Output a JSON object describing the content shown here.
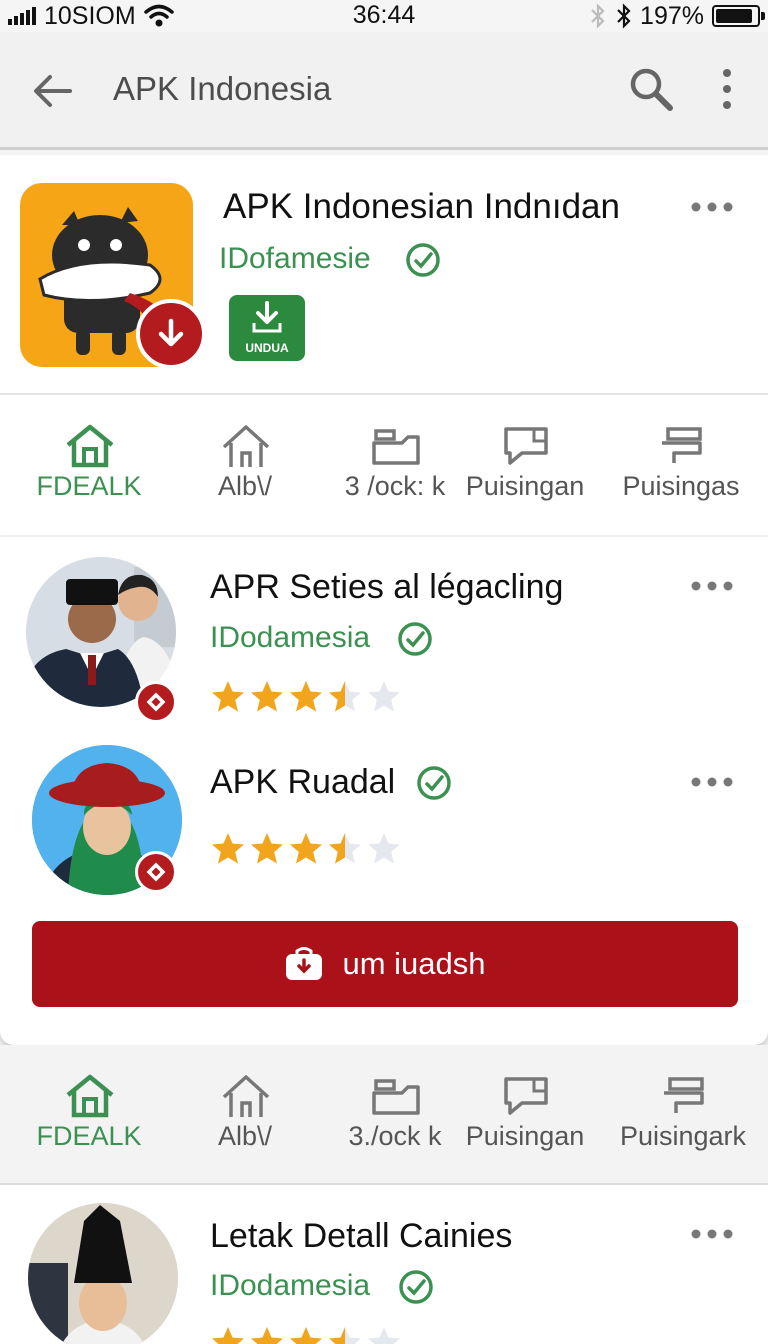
{
  "status": {
    "carrier": "10SIOM",
    "time": "36:44",
    "battery": "197%",
    "battery_level": 0.9
  },
  "app_bar": {
    "title": "APK Indonesia",
    "back_icon": "arrow-left-icon",
    "search_icon": "search-icon",
    "more_icon": "more-vertical-icon"
  },
  "featured": {
    "title": "APK Indonesian Indnıdan",
    "publisher": "IDofamesie",
    "download_label": "UNDUA"
  },
  "nav": {
    "items": [
      {
        "label": "FDEALK",
        "icon": "home-icon"
      },
      {
        "label": "Alb\\/",
        "icon": "home-outline-icon"
      },
      {
        "label": "3 /ock: k",
        "icon": "tray-icon"
      },
      {
        "label": "Puisingan",
        "icon": "chat-icon"
      },
      {
        "label": "Puisingas",
        "icon": "tag-icon"
      }
    ]
  },
  "nav2": {
    "items": [
      {
        "label": "FDEALK"
      },
      {
        "label": "Alb\\/"
      },
      {
        "label": "3./ock k"
      },
      {
        "label": "Puisingan"
      },
      {
        "label": "Puisingark"
      }
    ]
  },
  "list": {
    "items": [
      {
        "title": "APR Seties al légacling",
        "publisher": "IDodamesia",
        "rating": 3.5
      },
      {
        "title": "APK Ruadal",
        "publisher": "",
        "rating": 3.5
      }
    ],
    "button_label": "um iuadsh"
  },
  "bottom": {
    "title": "Letak Detall Cainies",
    "publisher": "IDodamesia"
  },
  "colors": {
    "green": "#3c9152",
    "red": "#ab1118",
    "orange": "#f6a516",
    "star": "#f0a51c"
  }
}
